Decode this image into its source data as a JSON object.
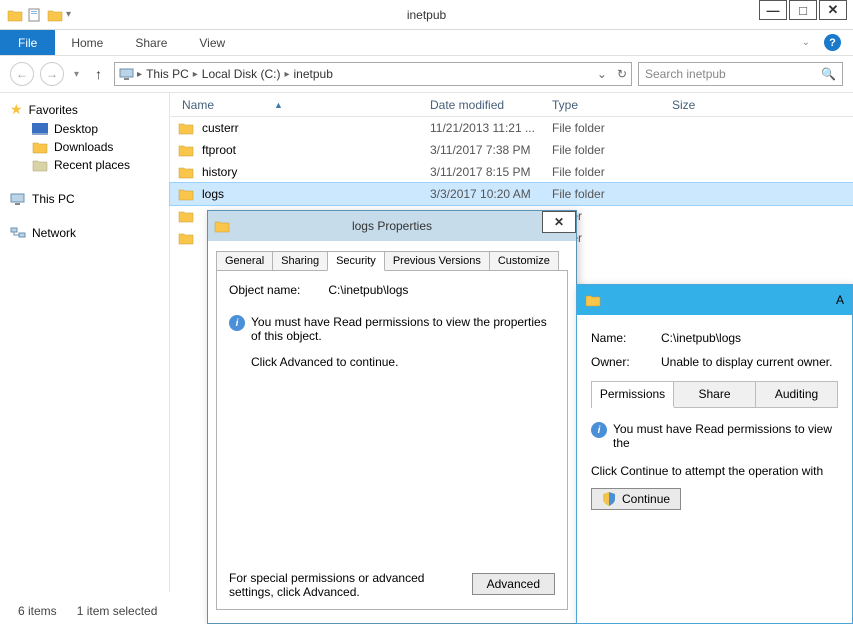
{
  "window": {
    "title": "inetpub"
  },
  "ribbon": {
    "file": "File",
    "home": "Home",
    "share": "Share",
    "view": "View"
  },
  "path": {
    "crumb1": "This PC",
    "crumb2": "Local Disk (C:)",
    "crumb3": "inetpub"
  },
  "search": {
    "placeholder": "Search inetpub"
  },
  "columns": {
    "name": "Name",
    "date": "Date modified",
    "type": "Type",
    "size": "Size"
  },
  "sidebar": {
    "favorites": "Favorites",
    "desktop": "Desktop",
    "downloads": "Downloads",
    "recent": "Recent places",
    "thispc": "This PC",
    "network": "Network"
  },
  "rows": [
    {
      "name": "custerr",
      "date": "11/21/2013 11:21 ...",
      "type": "File folder"
    },
    {
      "name": "ftproot",
      "date": "3/11/2017 7:38 PM",
      "type": "File folder"
    },
    {
      "name": "history",
      "date": "3/11/2017 8:15 PM",
      "type": "File folder"
    },
    {
      "name": "logs",
      "date": "3/3/2017 10:20 AM",
      "type": "File folder"
    },
    {
      "name": "",
      "date": "",
      "type": "folder"
    },
    {
      "name": "",
      "date": "",
      "type": "folder"
    }
  ],
  "status": {
    "count": "6 items",
    "selected": "1 item selected"
  },
  "props": {
    "title": "logs Properties",
    "tabs": {
      "general": "General",
      "sharing": "Sharing",
      "security": "Security",
      "previous": "Previous Versions",
      "customize": "Customize"
    },
    "obj_label": "Object name:",
    "obj_value": "C:\\inetpub\\logs",
    "msg1": "You must have Read permissions to view the properties of this object.",
    "msg2": "Click Advanced to continue.",
    "note": "For special permissions or advanced settings, click Advanced.",
    "adv_btn": "Advanced"
  },
  "adv": {
    "title_letter": "A",
    "name_k": "Name:",
    "name_v": "C:\\inetpub\\logs",
    "owner_k": "Owner:",
    "owner_v": "Unable to display current owner.",
    "tabs": {
      "perm": "Permissions",
      "share": "Share",
      "audit": "Auditing"
    },
    "msg": "You must have Read permissions to view the",
    "click": "Click Continue to attempt the operation with",
    "continue": "Continue"
  }
}
